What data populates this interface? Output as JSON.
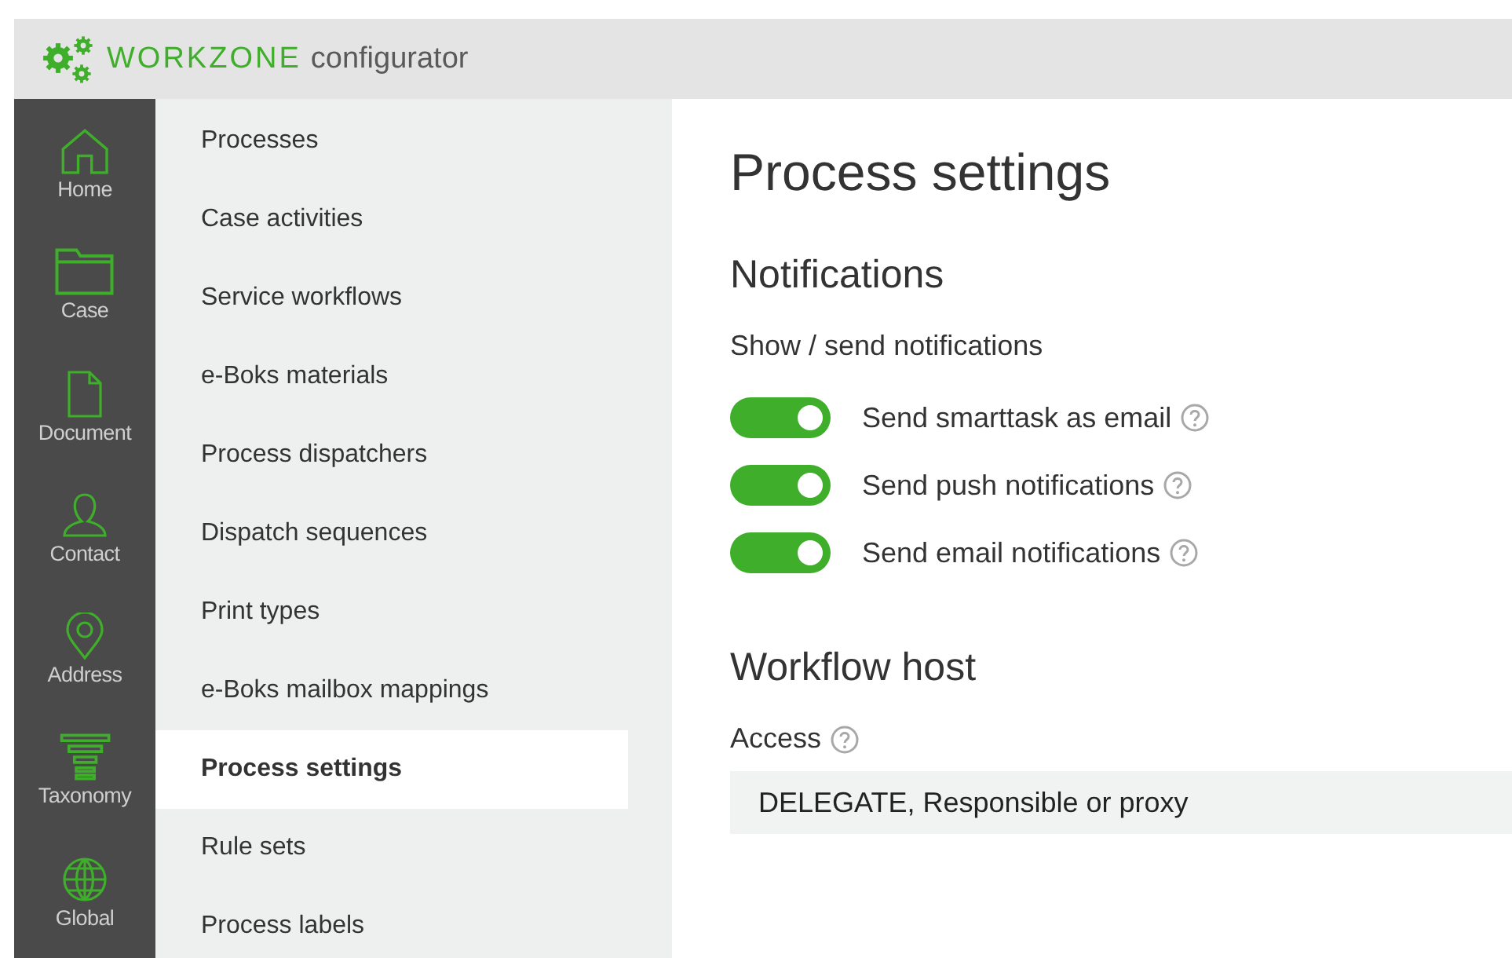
{
  "header": {
    "brand": "WORKZONE",
    "product": "configurator"
  },
  "nav": [
    {
      "label": "Home",
      "kind": "home"
    },
    {
      "label": "Case",
      "kind": "folder"
    },
    {
      "label": "Document",
      "kind": "document"
    },
    {
      "label": "Contact",
      "kind": "person"
    },
    {
      "label": "Address",
      "kind": "pin"
    },
    {
      "label": "Taxonomy",
      "kind": "stack"
    },
    {
      "label": "Global",
      "kind": "globe"
    }
  ],
  "submenu": [
    {
      "label": "Processes",
      "selected": false
    },
    {
      "label": "Case activities",
      "selected": false
    },
    {
      "label": "Service workflows",
      "selected": false
    },
    {
      "label": "e-Boks materials",
      "selected": false
    },
    {
      "label": "Process dispatchers",
      "selected": false
    },
    {
      "label": "Dispatch sequences",
      "selected": false
    },
    {
      "label": "Print types",
      "selected": false
    },
    {
      "label": "e-Boks mailbox mappings",
      "selected": false
    },
    {
      "label": "Process settings",
      "selected": true
    },
    {
      "label": "Rule sets",
      "selected": false
    },
    {
      "label": "Process labels",
      "selected": false
    }
  ],
  "content": {
    "title": "Process settings",
    "sections": [
      {
        "heading": "Notifications",
        "kind": "toggles",
        "label": "Show / send notifications",
        "toggles": [
          {
            "label": "Send smarttask as email",
            "on": true
          },
          {
            "label": "Send push notifications",
            "on": true
          },
          {
            "label": "Send email notifications",
            "on": true
          }
        ]
      },
      {
        "heading": "Workflow host",
        "kind": "field",
        "label": "Access",
        "value": "DELEGATE, Responsible or proxy"
      }
    ]
  }
}
